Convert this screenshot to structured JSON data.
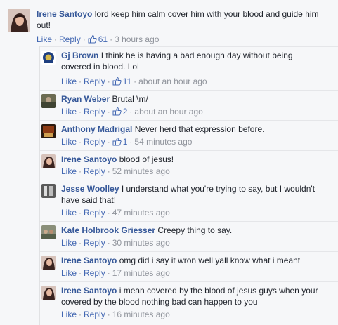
{
  "comments": [
    {
      "name": "Irene Santoyo",
      "text_line1": "lord keep him calm cover him with your blood and guide him",
      "text_line2": "out!",
      "actions": {
        "like": "Like",
        "reply": "Reply",
        "like_count": "61",
        "time": "3 hours ago"
      }
    }
  ],
  "replies": [
    {
      "name": "Gj Brown",
      "text_line1": "I think he is having a bad enough day without being",
      "text_line2": "covered in blood. Lol",
      "actions": {
        "like": "Like",
        "reply": "Reply",
        "like_count": "11",
        "time": "about an hour ago"
      }
    },
    {
      "name": "Ryan Weber",
      "text_line1": "Brutal \\m/",
      "actions": {
        "like": "Like",
        "reply": "Reply",
        "like_count": "2",
        "time": "about an hour ago"
      }
    },
    {
      "name": "Anthony Madrigal",
      "text_line1": "Never herd that expression before.",
      "actions": {
        "like": "Like",
        "reply": "Reply",
        "like_count": "1",
        "time": "54 minutes ago"
      }
    },
    {
      "name": "Irene Santoyo",
      "text_line1": "blood of jesus!",
      "actions": {
        "like": "Like",
        "reply": "Reply",
        "time": "52 minutes ago"
      }
    },
    {
      "name": "Jesse Woolley",
      "text_line1": "I understand what you're trying to say, but I wouldn't",
      "text_line2": "have said that!",
      "actions": {
        "like": "Like",
        "reply": "Reply",
        "time": "47 minutes ago"
      }
    },
    {
      "name": "Kate Holbrook Griesser",
      "text_line1": "Creepy thing to say.",
      "actions": {
        "like": "Like",
        "reply": "Reply",
        "time": "30 minutes ago"
      }
    },
    {
      "name": "Irene Santoyo",
      "text_line1": "omg did i say it wron well yall know what i meant",
      "actions": {
        "like": "Like",
        "reply": "Reply",
        "time": "17 minutes ago"
      }
    },
    {
      "name": "Irene Santoyo",
      "text_line1": "i mean covered by the blood of jesus guys when your",
      "text_line2": "covered by the blood nothing bad can happen to you",
      "actions": {
        "like": "Like",
        "reply": "Reply",
        "time": "16 minutes ago"
      }
    }
  ],
  "colors": {
    "name": "#365899",
    "link": "#4267b2",
    "meta": "#90949c",
    "text": "#1d2129"
  }
}
